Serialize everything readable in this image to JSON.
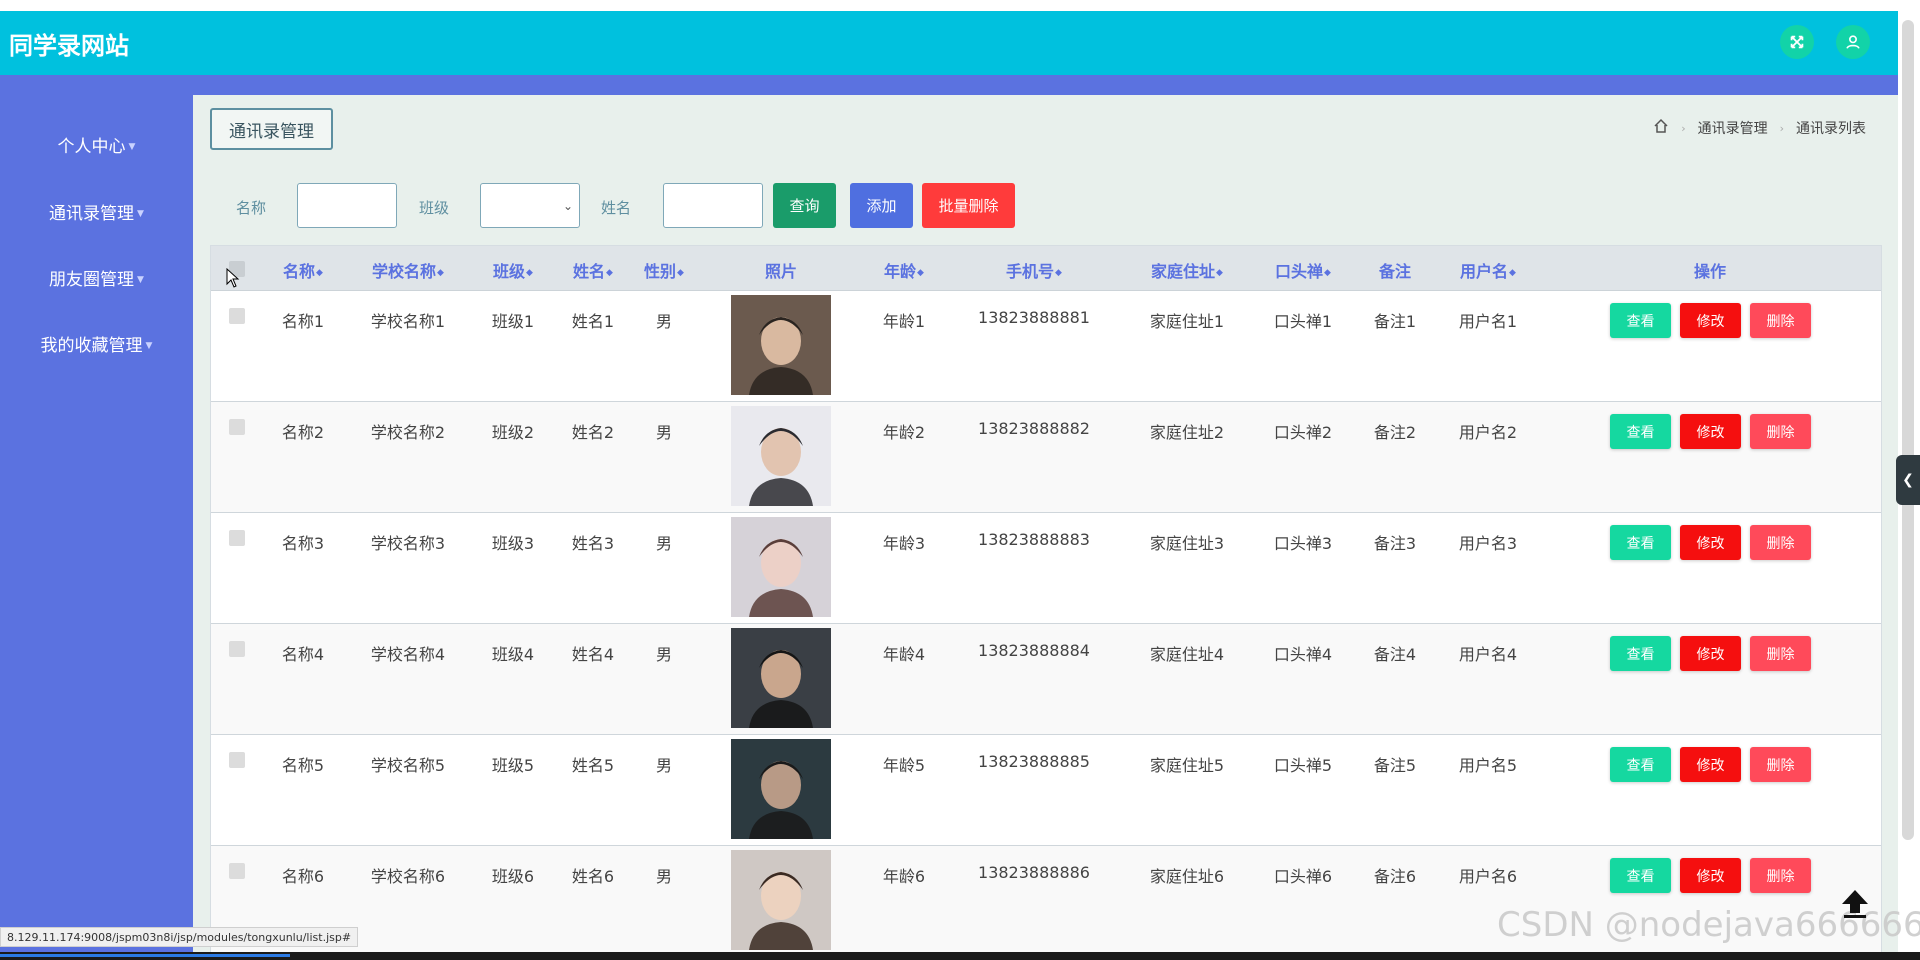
{
  "app": {
    "title": "同学录网站"
  },
  "header": {
    "icons": [
      "fullscreen-icon",
      "user-icon"
    ]
  },
  "sidebar": {
    "items": [
      {
        "label": "个人中心"
      },
      {
        "label": "通讯录管理"
      },
      {
        "label": "朋友圈管理"
      },
      {
        "label": "我的收藏管理"
      }
    ]
  },
  "page_tab": "通讯录管理",
  "breadcrumb": {
    "home_icon": "home-icon",
    "items": [
      "通讯录管理",
      "通讯录列表"
    ]
  },
  "search": {
    "name_label": "名称",
    "class_label": "班级",
    "person_label": "姓名",
    "query_button": "查询",
    "add_button": "添加",
    "batch_delete_button": "批量删除"
  },
  "table": {
    "headers": {
      "name": "名称",
      "school": "学校名称",
      "class": "班级",
      "person": "姓名",
      "gender": "性别",
      "photo": "照片",
      "age": "年龄",
      "phone": "手机号",
      "address": "家庭住址",
      "catchphrase": "口头禅",
      "remark": "备注",
      "username": "用户名",
      "actions": "操作"
    },
    "rows": [
      {
        "name": "名称1",
        "school": "学校名称1",
        "class": "班级1",
        "person": "姓名1",
        "gender": "男",
        "age": "年龄1",
        "phone": "13823888881",
        "address": "家庭住址1",
        "catchphrase": "口头禅1",
        "remark": "备注1",
        "username": "用户名1"
      },
      {
        "name": "名称2",
        "school": "学校名称2",
        "class": "班级2",
        "person": "姓名2",
        "gender": "男",
        "age": "年龄2",
        "phone": "13823888882",
        "address": "家庭住址2",
        "catchphrase": "口头禅2",
        "remark": "备注2",
        "username": "用户名2"
      },
      {
        "name": "名称3",
        "school": "学校名称3",
        "class": "班级3",
        "person": "姓名3",
        "gender": "男",
        "age": "年龄3",
        "phone": "13823888883",
        "address": "家庭住址3",
        "catchphrase": "口头禅3",
        "remark": "备注3",
        "username": "用户名3"
      },
      {
        "name": "名称4",
        "school": "学校名称4",
        "class": "班级4",
        "person": "姓名4",
        "gender": "男",
        "age": "年龄4",
        "phone": "13823888884",
        "address": "家庭住址4",
        "catchphrase": "口头禅4",
        "remark": "备注4",
        "username": "用户名4"
      },
      {
        "name": "名称5",
        "school": "学校名称5",
        "class": "班级5",
        "person": "姓名5",
        "gender": "男",
        "age": "年龄5",
        "phone": "13823888885",
        "address": "家庭住址5",
        "catchphrase": "口头禅5",
        "remark": "备注5",
        "username": "用户名5"
      },
      {
        "name": "名称6",
        "school": "学校名称6",
        "class": "班级6",
        "person": "姓名6",
        "gender": "男",
        "age": "年龄6",
        "phone": "13823888886",
        "address": "家庭住址6",
        "catchphrase": "口头禅6",
        "remark": "备注6",
        "username": "用户名6"
      }
    ],
    "action_labels": {
      "view": "查看",
      "edit": "修改",
      "delete": "删除"
    }
  },
  "status_url": "8.129.11.174:9008/jspm03n8i/jsp/modules/tongxunlu/list.jsp#",
  "watermark": "CSDN @nodejava666666",
  "colors": {
    "header": "#00c1de",
    "sidebar": "#5b72e0",
    "query": "#1a9c6a",
    "add": "#4f6fe0",
    "batch_delete": "#ff3b3b",
    "view": "#15d8a0",
    "edit": "#f50f0f",
    "delete": "#ff4a5a"
  }
}
